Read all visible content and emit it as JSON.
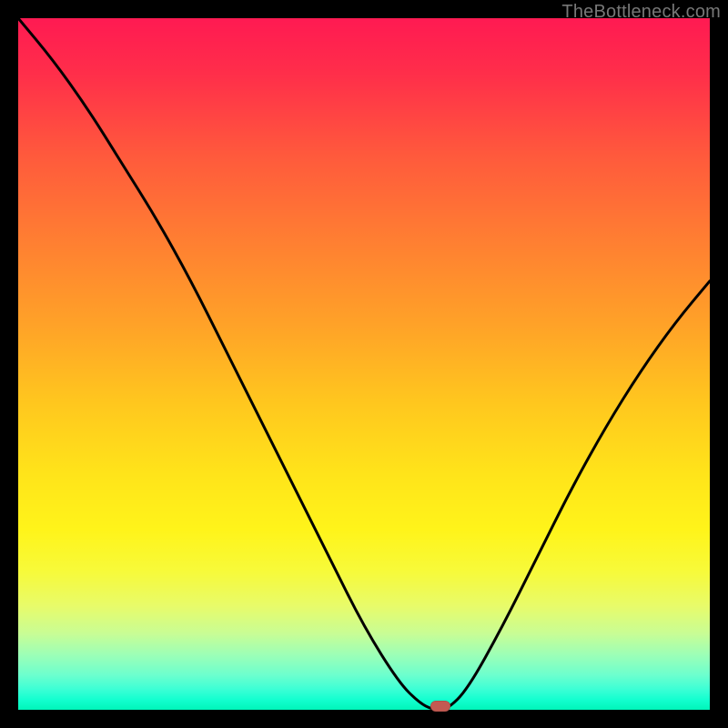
{
  "watermark": {
    "text": "TheBottleneck.com"
  },
  "chart_data": {
    "type": "line",
    "title": "",
    "xlabel": "",
    "ylabel": "",
    "xlim": [
      0,
      100
    ],
    "ylim": [
      0,
      100
    ],
    "grid": false,
    "legend": false,
    "series": [
      {
        "name": "bottleneck-curve",
        "x": [
          0,
          5,
          10,
          15,
          20,
          25,
          30,
          35,
          40,
          45,
          50,
          55,
          58,
          60,
          62,
          65,
          70,
          75,
          80,
          85,
          90,
          95,
          100
        ],
        "values": [
          100,
          94,
          87,
          79,
          71,
          62,
          52,
          42,
          32,
          22,
          12,
          4,
          1,
          0,
          0,
          3,
          12,
          22,
          32,
          41,
          49,
          56,
          62
        ]
      }
    ],
    "min_marker": {
      "x": 61,
      "y": 0
    },
    "gradient_stops": [
      {
        "pos": 0,
        "color": "#ff1a52"
      },
      {
        "pos": 0.5,
        "color": "#ffd11a"
      },
      {
        "pos": 1.0,
        "color": "#00f5b9"
      }
    ],
    "marker_color": "#c35a52"
  }
}
